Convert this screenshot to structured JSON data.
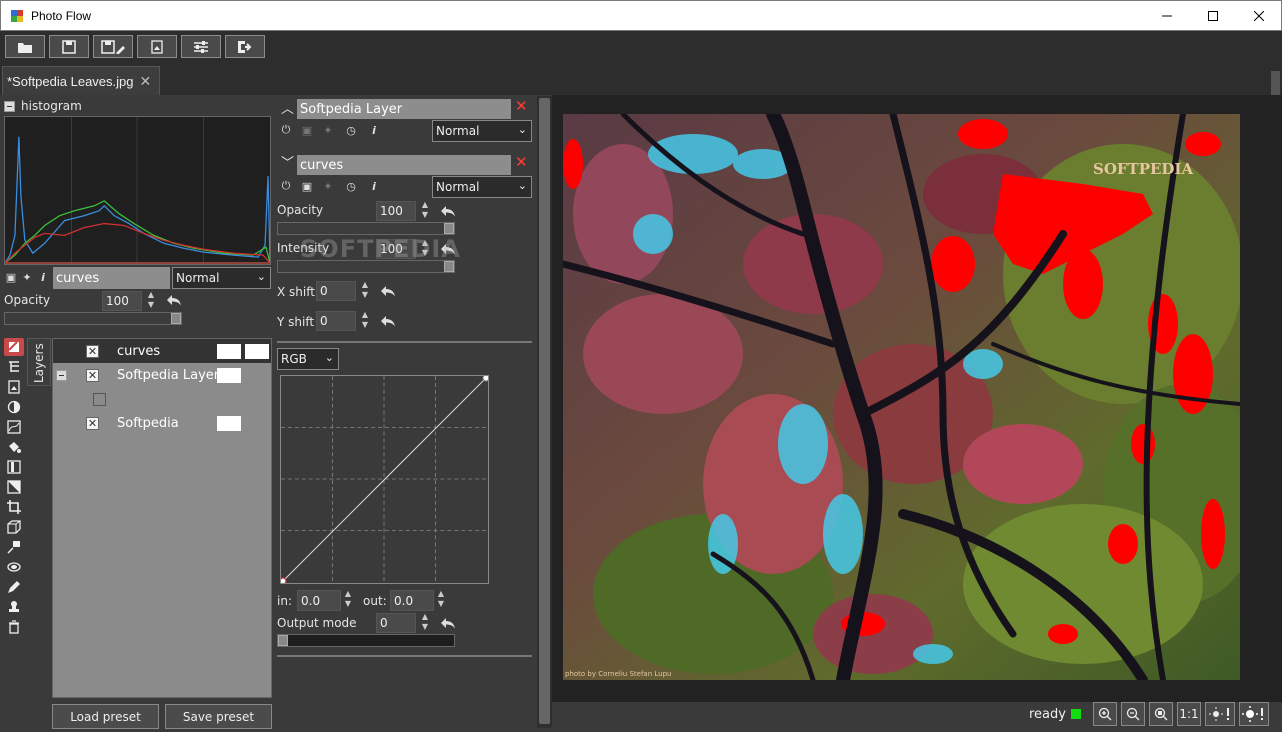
{
  "window": {
    "title": "Photo Flow"
  },
  "toolbar": {
    "buttons": [
      "open-icon",
      "save-icon",
      "save-as-icon",
      "export-icon",
      "settings-icon",
      "exit-icon"
    ]
  },
  "tabs": [
    {
      "label": "*Softpedia Leaves.jpg"
    }
  ],
  "histogram": {
    "label": "histogram"
  },
  "left_layer": {
    "name": "curves",
    "blend": "Normal",
    "opacity_label": "Opacity",
    "opacity_value": "100",
    "opacity_level": 1.0
  },
  "layers_panel": {
    "tab_label": "Layers",
    "rows": [
      {
        "name": "curves"
      },
      {
        "name": "Softpedia Layer"
      },
      {
        "name": "Softpedia"
      }
    ],
    "load_preset": "Load preset",
    "save_preset": "Save preset"
  },
  "mid": {
    "layer1": {
      "name": "Softpedia Layer",
      "blend": "Normal"
    },
    "layer2": {
      "name": "curves",
      "blend": "Normal"
    },
    "opacity": {
      "label": "Opacity",
      "value": "100",
      "level": 1.0
    },
    "intensity": {
      "label": "Intensity",
      "value": "100",
      "level": 1.0
    },
    "xshift": {
      "label": "X shift",
      "value": "0"
    },
    "yshift": {
      "label": "Y shift",
      "value": "0"
    },
    "channel": "RGB",
    "in_label": "in:",
    "in_value": "0.0",
    "out_label": "out:",
    "out_value": "0.0",
    "output_mode": {
      "label": "Output mode",
      "value": "0",
      "level": 0.0
    }
  },
  "watermark": "SOFTPEDIA",
  "image": {
    "brand_text": "SOFTPEDIA",
    "credit": "photo by Corneliu Stefan Lupu"
  },
  "status": {
    "text": "ready",
    "led_color": "#11dd11",
    "buttons": [
      "zoom-in-icon",
      "zoom-out-icon",
      "zoom-fit-icon",
      "1:1",
      "shadows-clipping-icon",
      "highlights-clipping-icon"
    ],
    "one_to_one": "1:1"
  }
}
